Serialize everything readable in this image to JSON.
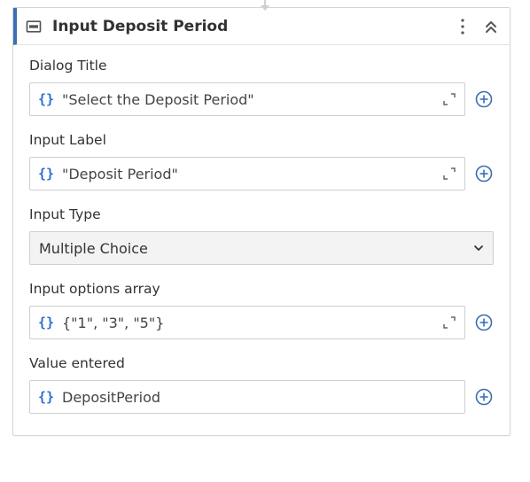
{
  "node": {
    "title": "Input Deposit Period",
    "fields": {
      "dialogTitle": {
        "label": "Dialog Title",
        "value": "\"Select the Deposit Period\"",
        "showExpand": true,
        "showPlus": true
      },
      "inputLabel": {
        "label": "Input Label",
        "value": "\"Deposit Period\"",
        "showExpand": true,
        "showPlus": true
      },
      "inputType": {
        "label": "Input Type",
        "selected": "Multiple Choice"
      },
      "optionsArray": {
        "label": "Input options array",
        "value": "{\"1\", \"3\", \"5\"}",
        "showExpand": true,
        "showPlus": true
      },
      "valueEntered": {
        "label": "Value entered",
        "value": "DepositPeriod",
        "showExpand": false,
        "showPlus": true
      }
    }
  },
  "glyphs": {
    "braces": "{}"
  }
}
